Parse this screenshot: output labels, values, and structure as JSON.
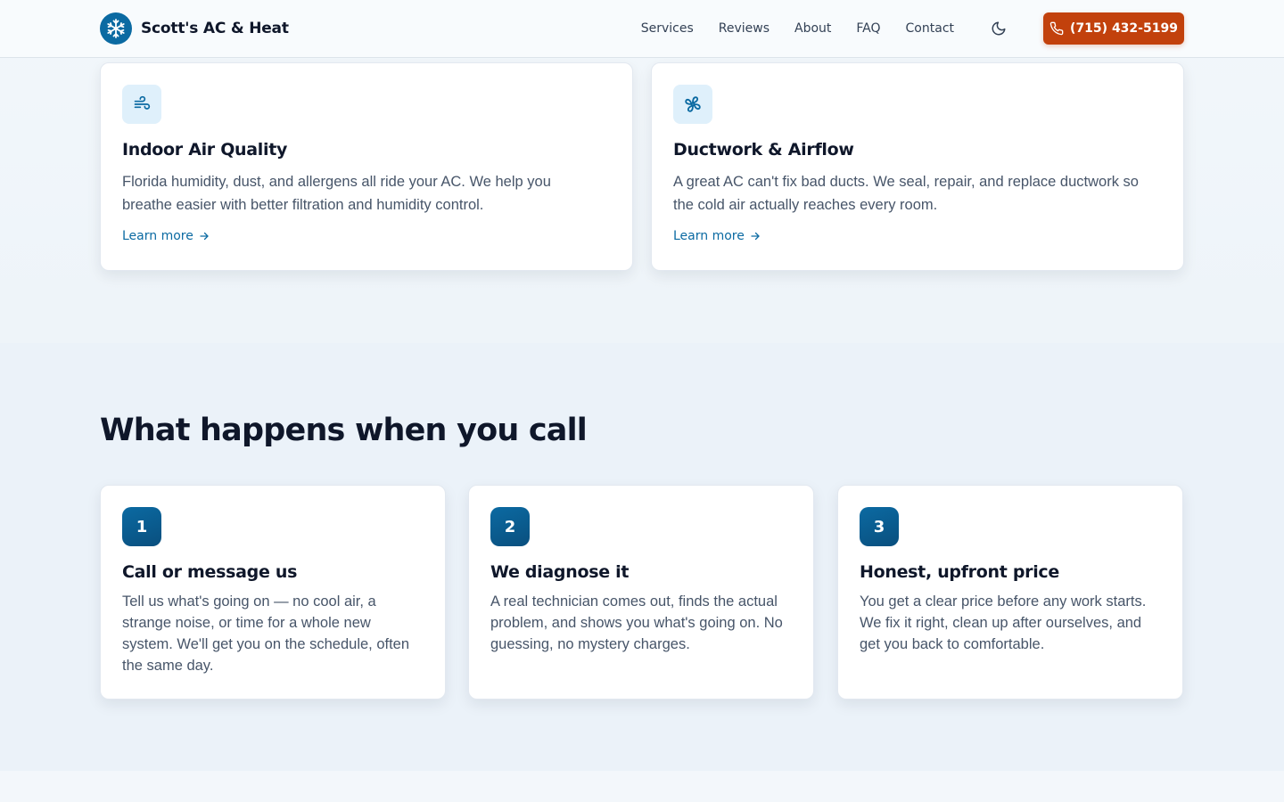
{
  "header": {
    "brand_name": "Scott's AC & Heat",
    "logo_icon": "snowflake-icon",
    "nav": [
      "Services",
      "Reviews",
      "About",
      "FAQ",
      "Contact"
    ],
    "theme_icon": "moon-icon",
    "call_label": "(715) 432-5199",
    "call_icon": "phone-icon"
  },
  "services": {
    "cards": [
      {
        "icon": "wind-icon",
        "title": "Indoor Air Quality",
        "description": "Florida humidity, dust, and allergens all ride your AC. We help you breathe easier with better filtration and humidity control.",
        "link": "Learn more"
      },
      {
        "icon": "fan-icon",
        "title": "Ductwork & Airflow",
        "description": "A great AC can't fix bad ducts. We seal, repair, and replace ductwork so the cold air actually reaches every room.",
        "link": "Learn more"
      }
    ]
  },
  "steps": {
    "title": "What happens when you call",
    "items": [
      {
        "number": "1",
        "title": "Call or message us",
        "description": "Tell us what's going on — no cool air, a strange noise, or time for a whole new system. We'll get you on the schedule, often the same day."
      },
      {
        "number": "2",
        "title": "We diagnose it",
        "description": "A real technician comes out, finds the actual problem, and shows you what's going on. No guessing, no mystery charges."
      },
      {
        "number": "3",
        "title": "Honest, upfront price",
        "description": "You get a clear price before any work starts. We fix it right, clean up after ourselves, and get you back to comfortable."
      }
    ]
  },
  "colors": {
    "brand_blue": "#0b6aa2",
    "call_orange": "#c2410c",
    "text_dark": "#0f172a",
    "text_muted": "#475569"
  }
}
